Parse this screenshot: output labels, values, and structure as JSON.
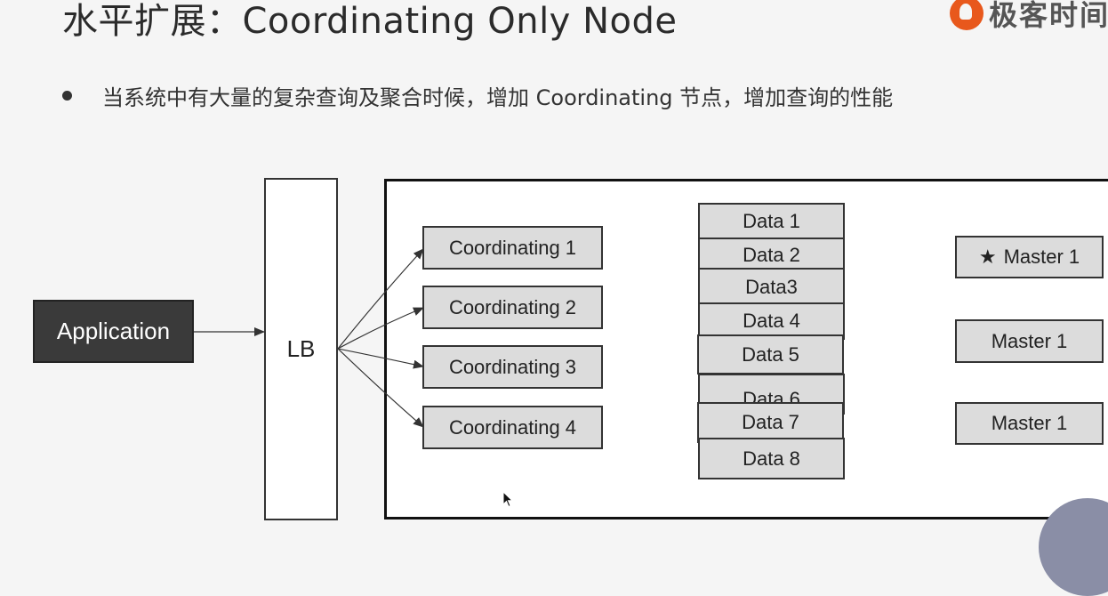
{
  "slide": {
    "title": "水平扩展：Coordinating Only Node",
    "logo_text": "极客时间",
    "bullet": "当系统中有大量的复杂查询及聚合时候，增加 Coordinating 节点，增加查询的性能"
  },
  "diagram": {
    "application": "Application",
    "lb": "LB",
    "coordinating": [
      "Coordinating 1",
      "Coordinating 2",
      "Coordinating 3",
      "Coordinating 4"
    ],
    "data": [
      "Data 1",
      "Data 2",
      "Data3",
      "Data 4",
      "Data 5",
      "Data 6",
      "Data 7",
      "Data 8"
    ],
    "masters": [
      "Master 1",
      "Master 1",
      "Master 1"
    ],
    "star_icon": "★"
  }
}
